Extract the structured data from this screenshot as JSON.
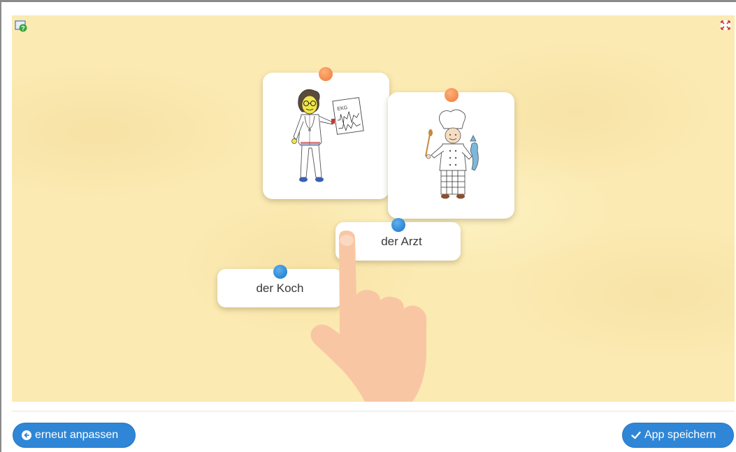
{
  "cards": {
    "doctor_word": "der Arzt",
    "cook_word": "der Koch",
    "ekg_text": "EKG"
  },
  "footer": {
    "back_label": "erneut anpassen",
    "save_label": "App speichern"
  },
  "colors": {
    "board_background": "#fbeab2",
    "pin_orange": "#f28a4a",
    "pin_blue": "#2d86d2",
    "button_blue": "#2f86d6"
  },
  "icons": {
    "help": "help-icon",
    "fullscreen": "fullscreen-icon",
    "back": "arrow-left-icon",
    "save": "checkmark-icon"
  }
}
